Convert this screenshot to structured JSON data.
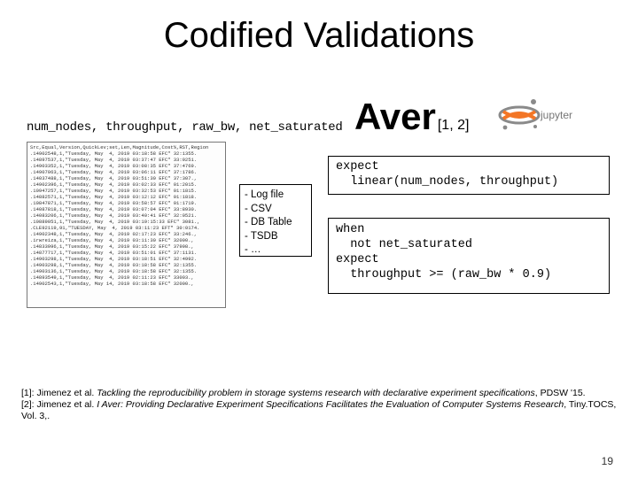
{
  "title": "Codified Validations",
  "schema": "num_nodes, throughput, raw_bw, net_saturated",
  "log_sample": "Src,Equal,Version,QuickLev;set,Len,Magnitude,Cost%,RST,Region\n.14902548,1,\"Tuesday, May  4, 2019 03:18:58 EFC\" 32:1355.\n.14897537,1,\"Tuesday, May  4, 2019 03:37:47 EFC\" 33:9251.\n.14903352,1,\"Tuesday, May  4, 2019 03:08:35 EFC\" 37:4769.\n.14907063,1,\"Tuesday, May  4, 2019 03:06:11 EFC\" 37:1786.\n.14037488,1,\"Tuesday, May  4, 2019 03:51:30 EFC\" 37:307.,\n.14902396,1,\"Tuesday, May  4, 2019 03:02:33 EFC\" 01:2015.\n.10947257,1,\"Tuesday, May  4, 2019 03:32:53 EFC\" 01:1815.\n.14882571,1,\"Tuesday, May  4, 2019 03:12:12 EFC\" 01:1818.\n.10847871,1,\"Tuesday, May  4, 2019 03:58:57 EFC\" 01:1719.\n.14087818,1,\"Tuesday, May  4, 2019 03:07:04 EFC\" 33:8930.\n.14083206,1,\"Tuesday, May  4, 2019 03:40:41 EFC\" 32:0521.\n.10889051,1,\"Tuesday, May  4, 2019 03:19:15:33 EFC\" 3081.,\n.CLE92119,91,\"TUESDAY, May  4, 2019 03:11:23 EFT\" 30:0174.\n.14902348,1,\"Tuesday, May  4, 2019 02:17:23 EFC\" 33:246.,\n.irwreiza,1,\"Tuesday, May  4, 2019 03:11:30 EFC\" 32000.,\n.14833996,1,\"Tuesday, May  4, 2019 03:15:22 EFC\" 37998.,\n.14877717,1,\"Tuesday, May  4, 2019 03:51:01 EFC\" 37:1131.\n.14903298,1,\"Tuesday, May  4, 2019 03:18:51 EFC\" 32:4992.\n.14903298,1,\"Tuesday, May  4, 2019 03:18:58 EFC\" 32:1355.\n.14903136,1,\"Tuesday, May  4, 2019 03:18:58 EFC\" 32:1355.\n.14893549,1,\"Tuesday, May  4, 2019 02:11:23 EFC\" 33003.,\n.14902543,1,\"Tuesday, May 14, 2019 03:18:58 EFC\" 32000.,",
  "sources_box": {
    "items": [
      "- Log file",
      "- CSV",
      "- DB Table",
      "- TSDB",
      "- …"
    ]
  },
  "aver": {
    "name": "Aver",
    "cite": "[1, 2]"
  },
  "jupyter_label": "jupyter",
  "code_block_1": "expect\n  linear(num_nodes, throughput)",
  "code_block_2": "when\n  not net_saturated\nexpect\n  throughput >= (raw_bw * 0.9)",
  "refs": {
    "r1_prefix": "[1]: Jimenez et al. ",
    "r1_title": "Tackling the reproducibility problem in storage systems research with declarative experiment specifications",
    "r1_suffix": ", PDSW '15.",
    "r2_prefix": "[2]: Jimenez et al. ",
    "r2_title": "I Aver: Providing Declarative Experiment Specifications Facilitates the Evaluation of Computer Systems Research",
    "r2_suffix": ", Tiny.TOCS, Vol. 3,."
  },
  "page_number": "19"
}
